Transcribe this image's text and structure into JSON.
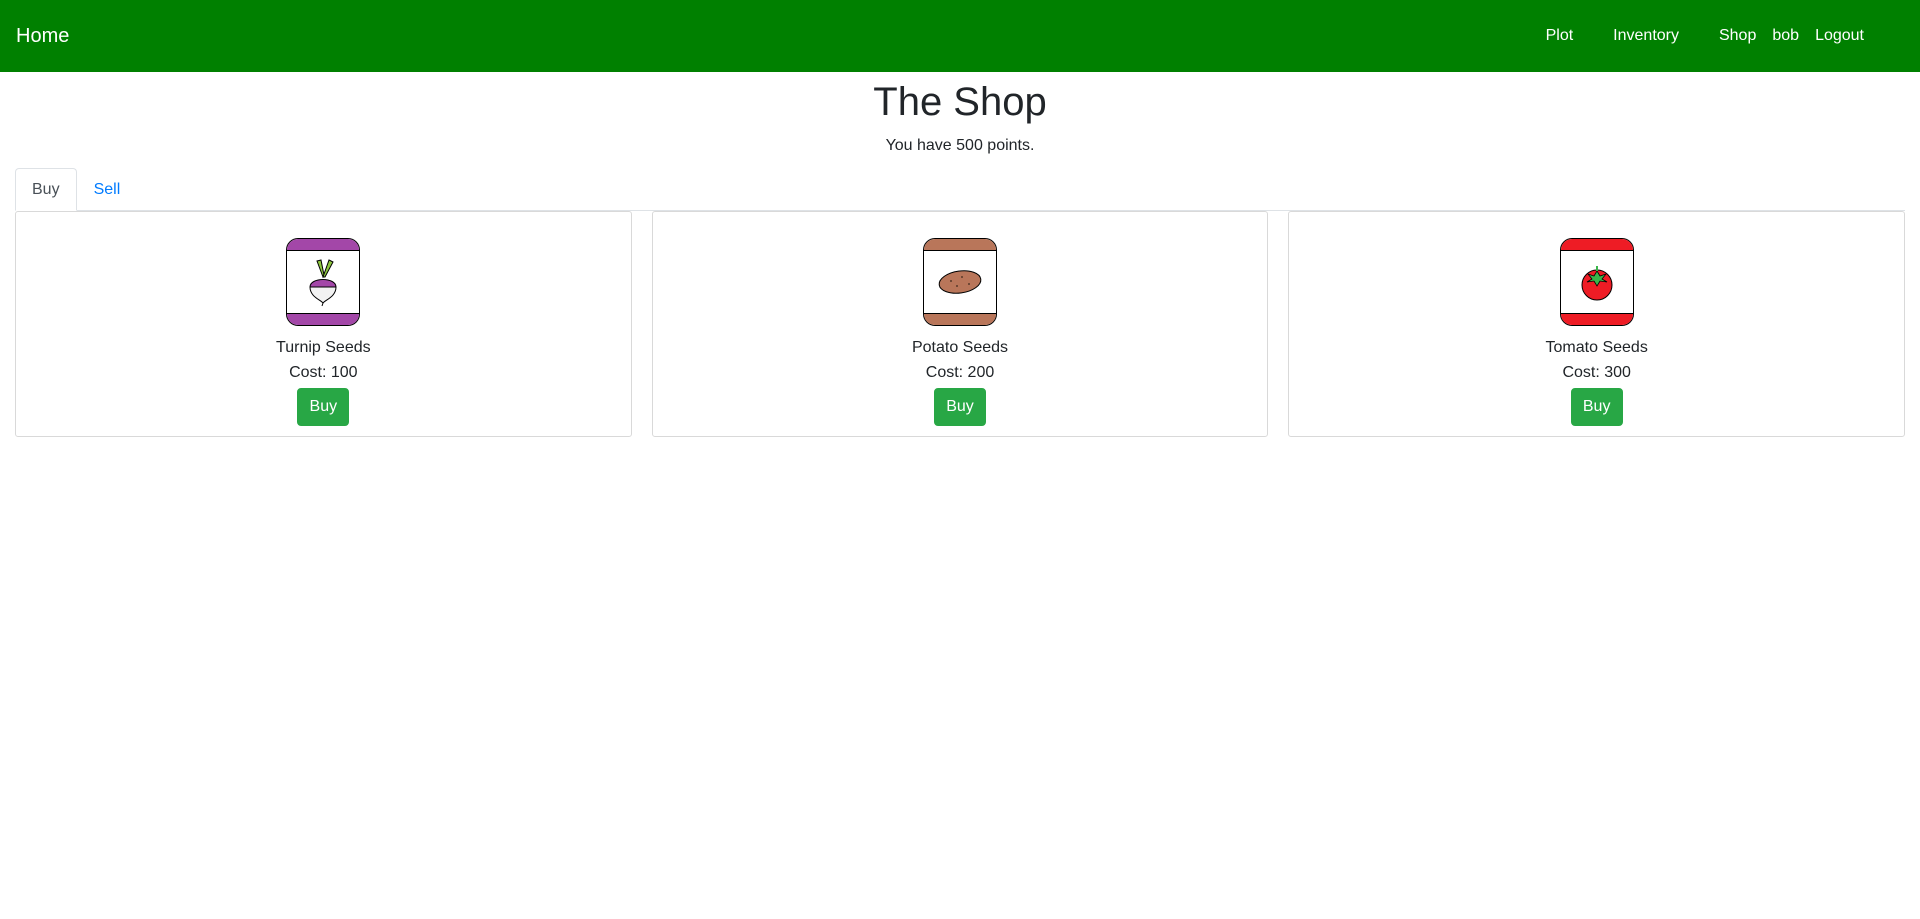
{
  "nav": {
    "brand": "Home",
    "links": [
      "Plot",
      "Inventory",
      "Shop",
      "bob",
      "Logout"
    ]
  },
  "page": {
    "title": "The Shop",
    "points_text": "You have 500 points."
  },
  "tabs": [
    {
      "label": "Buy",
      "active": true
    },
    {
      "label": "Sell",
      "active": false
    }
  ],
  "items": [
    {
      "name": "Turnip Seeds",
      "cost": "Cost: 100",
      "button": "Buy",
      "icon": "turnip-icon",
      "color": "#a347a8"
    },
    {
      "name": "Potato Seeds",
      "cost": "Cost: 200",
      "button": "Buy",
      "icon": "potato-icon",
      "color": "#b9765a"
    },
    {
      "name": "Tomato Seeds",
      "cost": "Cost: 300",
      "button": "Buy",
      "icon": "tomato-icon",
      "color": "#ee1c25"
    }
  ],
  "colors": {
    "navbar": "#008000",
    "buy_button": "#28a745",
    "link": "#007bff"
  }
}
